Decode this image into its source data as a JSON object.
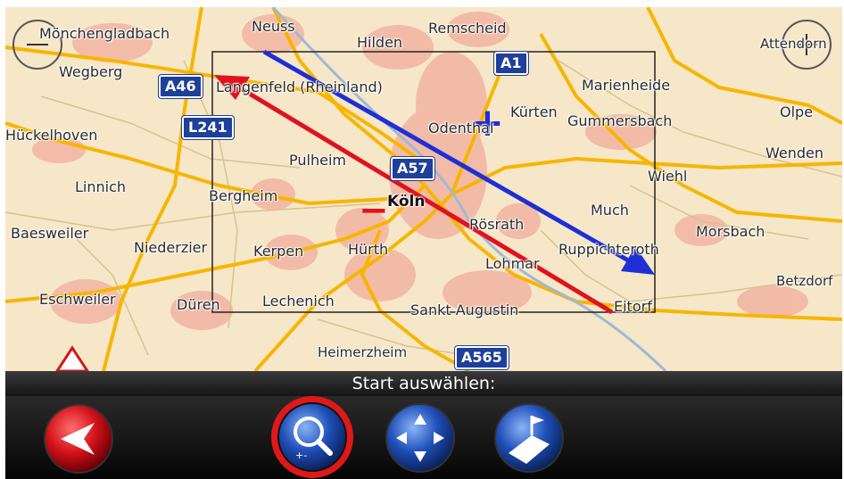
{
  "map": {
    "places": [
      {
        "name": "Mönchengladbach"
      },
      {
        "name": "Neuss"
      },
      {
        "name": "Remscheid"
      },
      {
        "name": "Hilden"
      },
      {
        "name": "Attendorn"
      },
      {
        "name": "Wegberg"
      },
      {
        "name": "Langenfeld (Rheinland)"
      },
      {
        "name": "Marienheide"
      },
      {
        "name": "Hückelhoven"
      },
      {
        "name": "Kürten"
      },
      {
        "name": "Gummersbach"
      },
      {
        "name": "Olpe"
      },
      {
        "name": "Odenthal"
      },
      {
        "name": "Wenden"
      },
      {
        "name": "Pulheim"
      },
      {
        "name": "Wiehl"
      },
      {
        "name": "Linnich"
      },
      {
        "name": "Bergheim"
      },
      {
        "name": "Köln"
      },
      {
        "name": "Much"
      },
      {
        "name": "Rösrath"
      },
      {
        "name": "Baesweiler"
      },
      {
        "name": "Morsbach"
      },
      {
        "name": "Niederzier"
      },
      {
        "name": "Kerpen"
      },
      {
        "name": "Hürth"
      },
      {
        "name": "Ruppichteroth"
      },
      {
        "name": "Lohmar"
      },
      {
        "name": "Betzdorf"
      },
      {
        "name": "Eschweiler"
      },
      {
        "name": "Düren"
      },
      {
        "name": "Lechenich"
      },
      {
        "name": "Sankt Augustin"
      },
      {
        "name": "Eitorf"
      },
      {
        "name": "Heimerzheim"
      }
    ],
    "road_shields": [
      {
        "label": "A46"
      },
      {
        "label": "A1"
      },
      {
        "label": "L241"
      },
      {
        "label": "A57"
      },
      {
        "label": "A565"
      }
    ],
    "zoom_in_symbol": "+",
    "zoom_out_symbol": "−",
    "colors": {
      "land": "#f6e7c9",
      "urban": "#f2b7a4",
      "major_road": "#f7b500",
      "zoom_in_arrow": "#1e2fd6",
      "zoom_out_arrow": "#e0121e"
    }
  },
  "status": {
    "text": "Start auswählen:"
  },
  "toolbar": {
    "buttons": [
      {
        "name": "back",
        "icon": "back-arrow-icon"
      },
      {
        "name": "zoom",
        "icon": "magnifier-zoom-icon",
        "selected": true
      },
      {
        "name": "pan",
        "icon": "move-arrows-icon"
      },
      {
        "name": "route",
        "icon": "route-flag-icon"
      }
    ]
  }
}
